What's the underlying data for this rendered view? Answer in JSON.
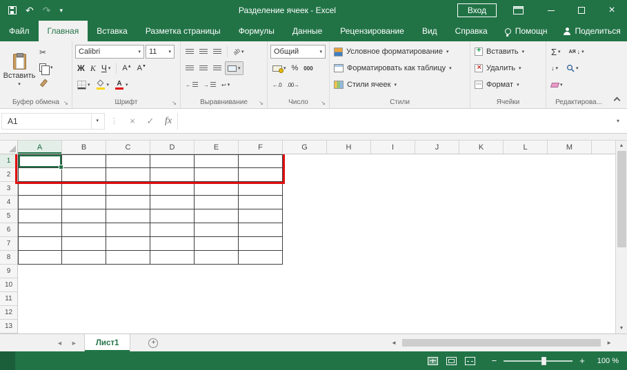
{
  "colors": {
    "accent": "#217346",
    "annotation_red": "#e10e0e"
  },
  "titlebar": {
    "title": "Разделение ячеек  -  Excel",
    "signin": "Вход"
  },
  "tabs": {
    "items": [
      "Файл",
      "Главная",
      "Вставка",
      "Разметка страницы",
      "Формулы",
      "Данные",
      "Рецензирование",
      "Вид",
      "Справка"
    ],
    "active": "Главная",
    "assistant": "Помощн",
    "share": "Поделиться"
  },
  "ribbon": {
    "clipboard": {
      "paste": "Вставить",
      "label": "Буфер обмена"
    },
    "font": {
      "family": "Calibri",
      "size": "11",
      "bold": "Ж",
      "italic": "К",
      "underline": "Ч",
      "label": "Шрифт"
    },
    "alignment": {
      "label": "Выравнивание"
    },
    "number": {
      "format": "Общий",
      "percent": "%",
      "thousands": "000",
      "inc_decimal": "←.0",
      "dec_decimal": ".00→",
      "label": "Число"
    },
    "styles": {
      "conditional": "Условное форматирование",
      "format_table": "Форматировать как таблицу",
      "cell_styles": "Стили ячеек",
      "label": "Стили"
    },
    "cells": {
      "insert": "Вставить",
      "delete": "Удалить",
      "format": "Формат",
      "label": "Ячейки"
    },
    "editing": {
      "sum": "Σ",
      "sort": "АЯ",
      "label": "Редактирова..."
    }
  },
  "formula_bar": {
    "name_box": "A1",
    "fx": "fx",
    "value": ""
  },
  "grid": {
    "columns": [
      "A",
      "B",
      "C",
      "D",
      "E",
      "F",
      "G",
      "H",
      "I",
      "J",
      "K",
      "L",
      "M"
    ],
    "rows": [
      "1",
      "2",
      "3",
      "4",
      "5",
      "6",
      "7",
      "8",
      "9",
      "10",
      "11",
      "12",
      "13"
    ],
    "active_cell": "A1",
    "table_cols": 6,
    "table_rows": 8,
    "highlight_cols": 6,
    "highlight_rows": 2
  },
  "sheet_tabs": {
    "active": "Лист1"
  },
  "status_bar": {
    "zoom": "100 %"
  }
}
